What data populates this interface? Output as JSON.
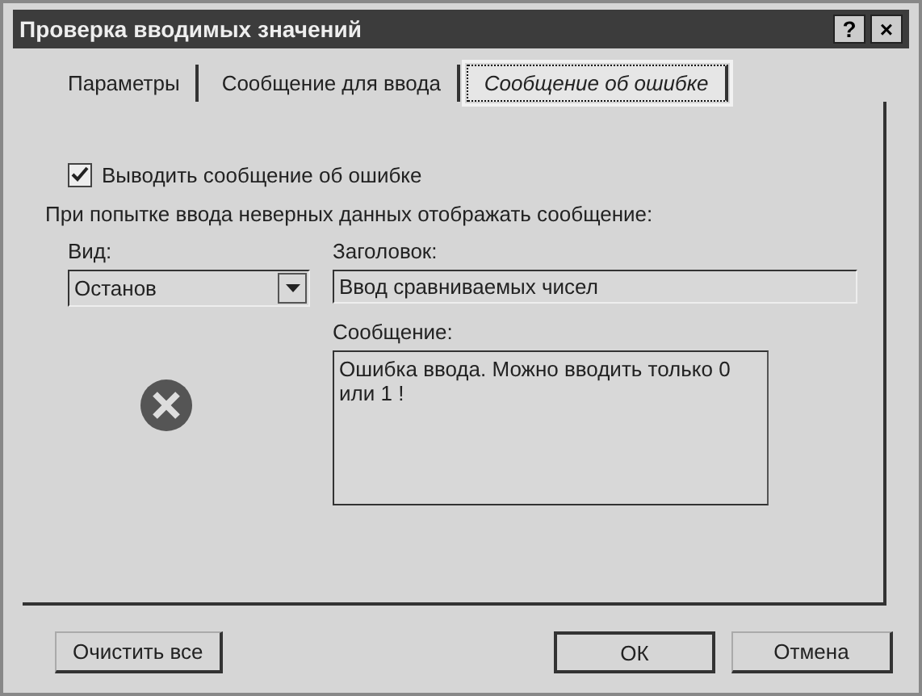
{
  "window": {
    "title": "Проверка вводимых значений",
    "help_button": "?",
    "close_button": "×"
  },
  "tabs": [
    {
      "label": "Параметры",
      "selected": false
    },
    {
      "label": "Сообщение для ввода",
      "selected": false
    },
    {
      "label": "Сообщение об ошибке",
      "selected": true
    }
  ],
  "show_error": {
    "label": "Выводить сообщение об ошибке",
    "checked": true
  },
  "prompt": "При попытке ввода неверных данных отображать сообщение:",
  "style": {
    "label": "Вид:",
    "value": "Останов"
  },
  "title_field": {
    "label": "Заголовок:",
    "value": "Ввод сравниваемых чисел"
  },
  "message_field": {
    "label": "Сообщение:",
    "value": "Ошибка ввода. Можно вводить только 0 или 1 !"
  },
  "buttons": [
    {
      "label": "Очистить все",
      "default": false
    },
    {
      "label": "ОК",
      "default": true
    },
    {
      "label": "Отмена",
      "default": false
    }
  ]
}
